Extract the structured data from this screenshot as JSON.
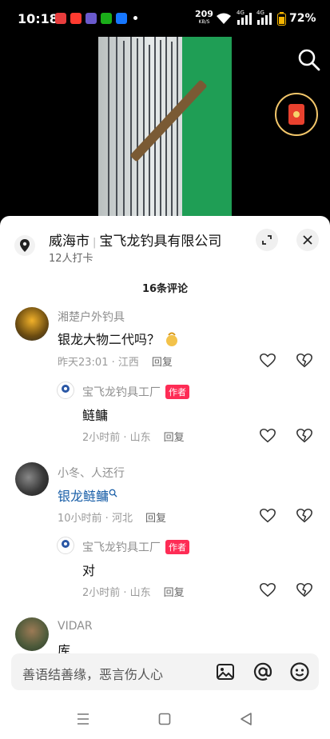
{
  "status_bar": {
    "time": "10:18",
    "net_speed": "209",
    "net_unit": "KB/S",
    "battery": "72%",
    "signal_1": "4G",
    "signal_2": "4G"
  },
  "location": {
    "city": "威海市",
    "name": "宝飞龙钓具有限公司",
    "checkins": "12人打卡"
  },
  "comments_count": "16条评论",
  "comments": [
    {
      "user": "湘楚户外钓具",
      "text": "银龙大物二代吗？",
      "time": "昨天23:01 · 江西",
      "reply_label": "回复",
      "replies": [
        {
          "user": "宝飞龙钓具工厂",
          "badge": "作者",
          "text": "鲢鳙",
          "time": "2小时前 · 山东",
          "reply_label": "回复"
        }
      ]
    },
    {
      "user": "小冬、人还行",
      "text": "银龙鲢鳙",
      "time": "10小时前 · 河北",
      "reply_label": "回复",
      "replies": [
        {
          "user": "宝飞龙钓具工厂",
          "badge": "作者",
          "text": "对",
          "time": "2小时前 · 山东",
          "reply_label": "回复"
        }
      ]
    },
    {
      "user": "VIDAR",
      "text": "库…"
    }
  ],
  "input": {
    "placeholder": "善语结善缘，恶言伤人心"
  },
  "colors": {
    "author_badge": "#fe2c55",
    "link": "#1a5fa8",
    "red_packet": "#e8412e"
  }
}
